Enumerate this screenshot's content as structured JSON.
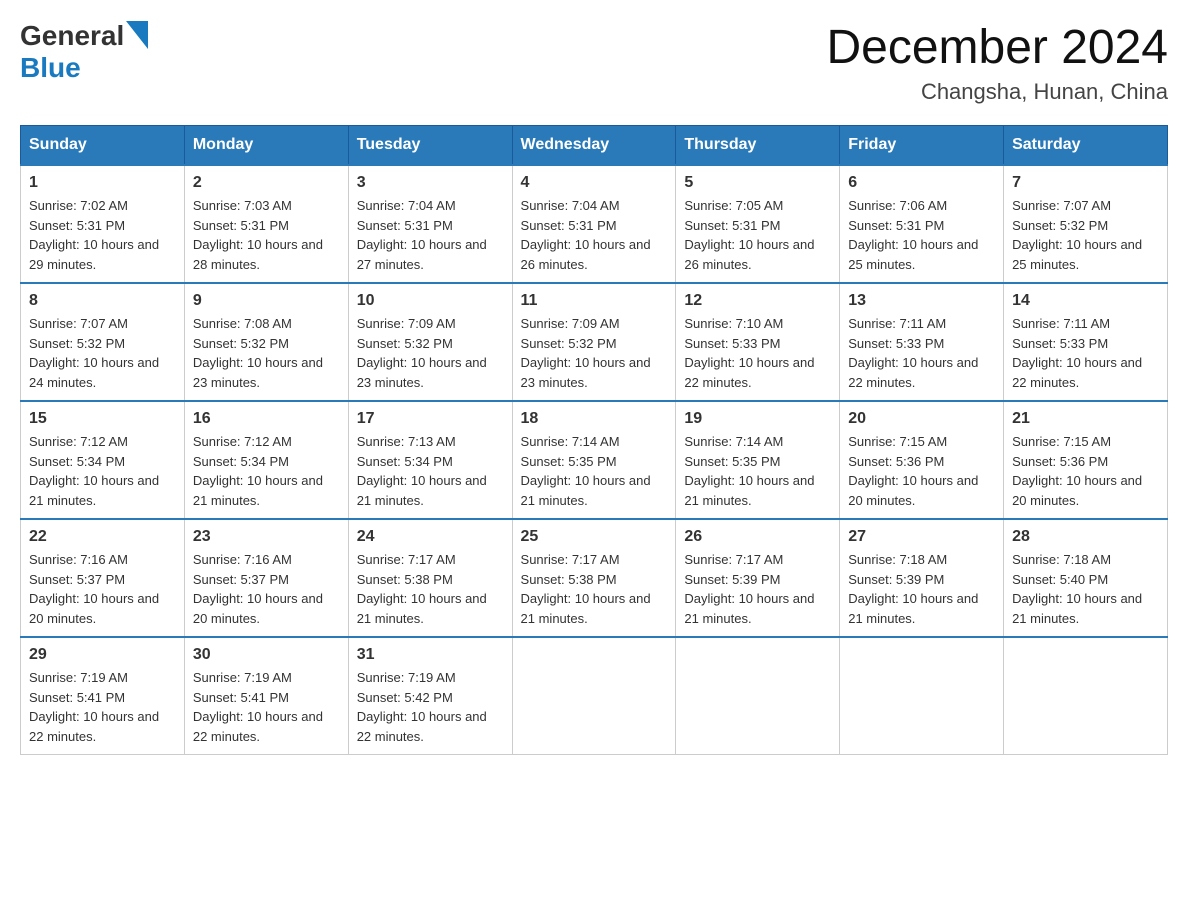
{
  "header": {
    "logo_general": "General",
    "logo_blue": "Blue",
    "month_year": "December 2024",
    "location": "Changsha, Hunan, China"
  },
  "weekdays": [
    "Sunday",
    "Monday",
    "Tuesday",
    "Wednesday",
    "Thursday",
    "Friday",
    "Saturday"
  ],
  "weeks": [
    [
      {
        "day": "1",
        "sunrise": "7:02 AM",
        "sunset": "5:31 PM",
        "daylight": "10 hours and 29 minutes."
      },
      {
        "day": "2",
        "sunrise": "7:03 AM",
        "sunset": "5:31 PM",
        "daylight": "10 hours and 28 minutes."
      },
      {
        "day": "3",
        "sunrise": "7:04 AM",
        "sunset": "5:31 PM",
        "daylight": "10 hours and 27 minutes."
      },
      {
        "day": "4",
        "sunrise": "7:04 AM",
        "sunset": "5:31 PM",
        "daylight": "10 hours and 26 minutes."
      },
      {
        "day": "5",
        "sunrise": "7:05 AM",
        "sunset": "5:31 PM",
        "daylight": "10 hours and 26 minutes."
      },
      {
        "day": "6",
        "sunrise": "7:06 AM",
        "sunset": "5:31 PM",
        "daylight": "10 hours and 25 minutes."
      },
      {
        "day": "7",
        "sunrise": "7:07 AM",
        "sunset": "5:32 PM",
        "daylight": "10 hours and 25 minutes."
      }
    ],
    [
      {
        "day": "8",
        "sunrise": "7:07 AM",
        "sunset": "5:32 PM",
        "daylight": "10 hours and 24 minutes."
      },
      {
        "day": "9",
        "sunrise": "7:08 AM",
        "sunset": "5:32 PM",
        "daylight": "10 hours and 23 minutes."
      },
      {
        "day": "10",
        "sunrise": "7:09 AM",
        "sunset": "5:32 PM",
        "daylight": "10 hours and 23 minutes."
      },
      {
        "day": "11",
        "sunrise": "7:09 AM",
        "sunset": "5:32 PM",
        "daylight": "10 hours and 23 minutes."
      },
      {
        "day": "12",
        "sunrise": "7:10 AM",
        "sunset": "5:33 PM",
        "daylight": "10 hours and 22 minutes."
      },
      {
        "day": "13",
        "sunrise": "7:11 AM",
        "sunset": "5:33 PM",
        "daylight": "10 hours and 22 minutes."
      },
      {
        "day": "14",
        "sunrise": "7:11 AM",
        "sunset": "5:33 PM",
        "daylight": "10 hours and 22 minutes."
      }
    ],
    [
      {
        "day": "15",
        "sunrise": "7:12 AM",
        "sunset": "5:34 PM",
        "daylight": "10 hours and 21 minutes."
      },
      {
        "day": "16",
        "sunrise": "7:12 AM",
        "sunset": "5:34 PM",
        "daylight": "10 hours and 21 minutes."
      },
      {
        "day": "17",
        "sunrise": "7:13 AM",
        "sunset": "5:34 PM",
        "daylight": "10 hours and 21 minutes."
      },
      {
        "day": "18",
        "sunrise": "7:14 AM",
        "sunset": "5:35 PM",
        "daylight": "10 hours and 21 minutes."
      },
      {
        "day": "19",
        "sunrise": "7:14 AM",
        "sunset": "5:35 PM",
        "daylight": "10 hours and 21 minutes."
      },
      {
        "day": "20",
        "sunrise": "7:15 AM",
        "sunset": "5:36 PM",
        "daylight": "10 hours and 20 minutes."
      },
      {
        "day": "21",
        "sunrise": "7:15 AM",
        "sunset": "5:36 PM",
        "daylight": "10 hours and 20 minutes."
      }
    ],
    [
      {
        "day": "22",
        "sunrise": "7:16 AM",
        "sunset": "5:37 PM",
        "daylight": "10 hours and 20 minutes."
      },
      {
        "day": "23",
        "sunrise": "7:16 AM",
        "sunset": "5:37 PM",
        "daylight": "10 hours and 20 minutes."
      },
      {
        "day": "24",
        "sunrise": "7:17 AM",
        "sunset": "5:38 PM",
        "daylight": "10 hours and 21 minutes."
      },
      {
        "day": "25",
        "sunrise": "7:17 AM",
        "sunset": "5:38 PM",
        "daylight": "10 hours and 21 minutes."
      },
      {
        "day": "26",
        "sunrise": "7:17 AM",
        "sunset": "5:39 PM",
        "daylight": "10 hours and 21 minutes."
      },
      {
        "day": "27",
        "sunrise": "7:18 AM",
        "sunset": "5:39 PM",
        "daylight": "10 hours and 21 minutes."
      },
      {
        "day": "28",
        "sunrise": "7:18 AM",
        "sunset": "5:40 PM",
        "daylight": "10 hours and 21 minutes."
      }
    ],
    [
      {
        "day": "29",
        "sunrise": "7:19 AM",
        "sunset": "5:41 PM",
        "daylight": "10 hours and 22 minutes."
      },
      {
        "day": "30",
        "sunrise": "7:19 AM",
        "sunset": "5:41 PM",
        "daylight": "10 hours and 22 minutes."
      },
      {
        "day": "31",
        "sunrise": "7:19 AM",
        "sunset": "5:42 PM",
        "daylight": "10 hours and 22 minutes."
      },
      null,
      null,
      null,
      null
    ]
  ],
  "labels": {
    "sunrise": "Sunrise:",
    "sunset": "Sunset:",
    "daylight": "Daylight:"
  }
}
